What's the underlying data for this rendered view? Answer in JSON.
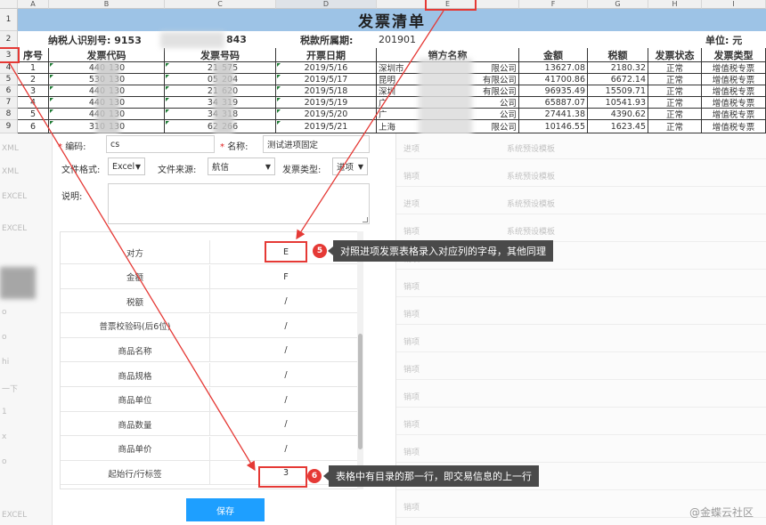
{
  "spreadsheet": {
    "columns": [
      "A",
      "B",
      "C",
      "D",
      "E",
      "F",
      "G",
      "H",
      "I"
    ],
    "row_numbers": [
      "1",
      "2",
      "3",
      "4",
      "5",
      "6",
      "7",
      "8",
      "9"
    ],
    "title": "发票清单",
    "taxpayer_id_label": "纳税人识别号: 9153",
    "taxpayer_id_tail": "843",
    "tax_period_label": "税款所属期:",
    "tax_period_value": "201901",
    "unit_label": "单位: 元",
    "headers": [
      "序号",
      "发票代码",
      "发票号码",
      "开票日期",
      "销方名称",
      "金额",
      "税额",
      "发票状态",
      "发票类型"
    ],
    "rows": [
      {
        "no": "1",
        "code_a": "440",
        "code_b": "130",
        "num_a": "21",
        "num_b": "575",
        "date": "2019/5/16",
        "seller_a": "深圳市",
        "seller_b": "限公司",
        "amount": "13627.08",
        "tax": "2180.32",
        "status": "正常",
        "type": "增值税专票"
      },
      {
        "no": "2",
        "code_a": "530",
        "code_b": "130",
        "num_a": "05",
        "num_b": "204",
        "date": "2019/5/17",
        "seller_a": "昆明",
        "seller_b": "有限公司",
        "amount": "41700.86",
        "tax": "6672.14",
        "status": "正常",
        "type": "增值税专票"
      },
      {
        "no": "3",
        "code_a": "440",
        "code_b": "130",
        "num_a": "21",
        "num_b": "620",
        "date": "2019/5/18",
        "seller_a": "深圳",
        "seller_b": "有限公司",
        "amount": "96935.49",
        "tax": "15509.71",
        "status": "正常",
        "type": "增值税专票"
      },
      {
        "no": "4",
        "code_a": "440",
        "code_b": "130",
        "num_a": "34",
        "num_b": "319",
        "date": "2019/5/19",
        "seller_a": "广",
        "seller_b": "公司",
        "amount": "65887.07",
        "tax": "10541.93",
        "status": "正常",
        "type": "增值税专票"
      },
      {
        "no": "5",
        "code_a": "440",
        "code_b": "130",
        "num_a": "34",
        "num_b": "318",
        "date": "2019/5/20",
        "seller_a": "广",
        "seller_b": "公司",
        "amount": "27441.38",
        "tax": "4390.62",
        "status": "正常",
        "type": "增值税专票"
      },
      {
        "no": "6",
        "code_a": "310",
        "code_b": "130",
        "num_a": "62",
        "num_b": "266",
        "date": "2019/5/21",
        "seller_a": "上海",
        "seller_b": "限公司",
        "amount": "10146.55",
        "tax": "1623.45",
        "status": "正常",
        "type": "增值税专票"
      }
    ]
  },
  "form": {
    "code_label": "编码:",
    "code_value": "cs",
    "name_label": "名称:",
    "name_value": "测试进项固定",
    "file_format_label": "文件格式:",
    "file_format_value": "Excel",
    "file_source_label": "文件来源:",
    "file_source_value": "航信",
    "invoice_type_label": "发票类型:",
    "invoice_type_value": "进项",
    "desc_label": "说明:",
    "mapping": [
      {
        "name": "对方",
        "value": "E"
      },
      {
        "name": "金额",
        "value": "F"
      },
      {
        "name": "税额",
        "value": "/"
      },
      {
        "name": "普票校验码(后6位)",
        "value": "/"
      },
      {
        "name": "商品名称",
        "value": "/"
      },
      {
        "name": "商品规格",
        "value": "/"
      },
      {
        "name": "商品单位",
        "value": "/"
      },
      {
        "name": "商品数量",
        "value": "/"
      },
      {
        "name": "商品单价",
        "value": "/"
      },
      {
        "name": "起始行/行标签",
        "value": "3"
      }
    ],
    "save_label": "保存"
  },
  "background": {
    "left_items": [
      "XML",
      "XML",
      "EXCEL",
      "EXCEL",
      "o",
      "o",
      "hi",
      "一下",
      "1",
      "x",
      "o",
      "EXCEL"
    ],
    "right_rows": [
      {
        "a": "进项",
        "b": "系统预设模板"
      },
      {
        "a": "销项",
        "b": "系统预设模板"
      },
      {
        "a": "进项",
        "b": "系统预设模板"
      },
      {
        "a": "销项",
        "b": "系统预设模板"
      },
      {
        "a": "销项",
        "b": ""
      },
      {
        "a": "销项",
        "b": ""
      },
      {
        "a": "销项",
        "b": ""
      },
      {
        "a": "销项",
        "b": ""
      },
      {
        "a": "销项",
        "b": ""
      },
      {
        "a": "销项",
        "b": ""
      },
      {
        "a": "销项",
        "b": ""
      },
      {
        "a": "销项",
        "b": ""
      },
      {
        "a": "销项",
        "b": ""
      },
      {
        "a": "销项",
        "b": ""
      }
    ]
  },
  "annotations": {
    "step5_number": "5",
    "step5_text": "对照进项发票表格录入对应列的字母，其他同理",
    "step6_number": "6",
    "step6_text": "表格中有目录的那一行，即交易信息的上一行",
    "accent_color": "#e53935",
    "watermark": "@金蝶云社区"
  }
}
